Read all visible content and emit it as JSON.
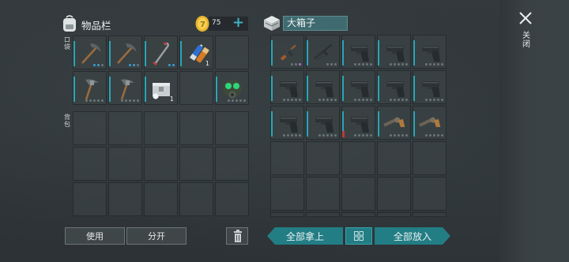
{
  "inventory": {
    "title": "物品栏",
    "coins": "75",
    "add_coin": "+",
    "pocket_label": "口袋",
    "backpack_label": "背包",
    "pocket_items": [
      {
        "name": "pickaxe",
        "dots": [
          "blue",
          "blue",
          "grey"
        ]
      },
      {
        "name": "pickaxe",
        "dots": [
          "blue",
          "blue",
          "grey"
        ]
      },
      {
        "name": "crowbar",
        "dots": [
          "blue",
          "blue"
        ]
      },
      {
        "name": "battery",
        "qty": "1"
      },
      {
        "name": "empty"
      },
      {
        "name": "hammer-pick"
      },
      {
        "name": "hammer-pick"
      },
      {
        "name": "metal-box",
        "qty": "1"
      },
      {
        "name": "empty"
      },
      {
        "name": "gas-mask"
      }
    ],
    "use_label": "使用",
    "split_label": "分开"
  },
  "box": {
    "title": "大箱子",
    "items": [
      {
        "name": "rifle-ak",
        "dots": [
          "grey",
          "grey",
          "purple"
        ]
      },
      {
        "name": "rifle",
        "dots": [
          "grey",
          "grey",
          "grey"
        ]
      },
      {
        "name": "pistol"
      },
      {
        "name": "pistol"
      },
      {
        "name": "pistol"
      },
      {
        "name": "pistol"
      },
      {
        "name": "pistol"
      },
      {
        "name": "pistol"
      },
      {
        "name": "pistol"
      },
      {
        "name": "pistol"
      },
      {
        "name": "pistol"
      },
      {
        "name": "pistol"
      },
      {
        "name": "pistol",
        "red": true
      },
      {
        "name": "revolver"
      },
      {
        "name": "revolver"
      }
    ],
    "take_all_label": "全部拿上",
    "put_all_label": "全部放入"
  },
  "close_label": "关闭",
  "colors": {
    "accent": "#2aa6b5",
    "button_teal": "#237d84"
  }
}
